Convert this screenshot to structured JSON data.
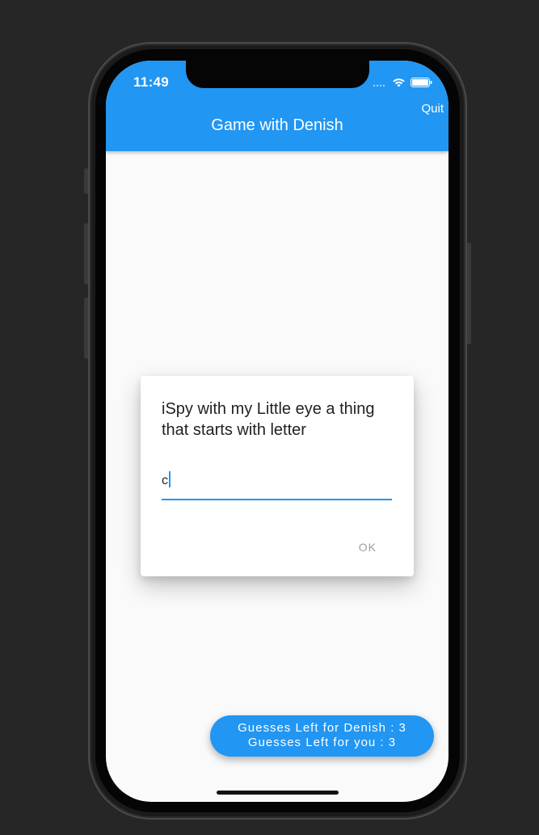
{
  "status_bar": {
    "time": "11:49"
  },
  "app_bar": {
    "title": "Game with Denish",
    "quit_label": "Quit",
    "color": "#2196f3"
  },
  "dialog": {
    "message": "iSpy with my Little eye a thing that starts with letter",
    "input_value": "c",
    "ok_label": "OK"
  },
  "fab": {
    "line1": "Guesses Left for Denish : 3",
    "line2": "Guesses Left for you : 3"
  },
  "icons": {
    "wifi": "wifi-icon",
    "battery": "battery-icon",
    "signal": "signal-icon"
  }
}
